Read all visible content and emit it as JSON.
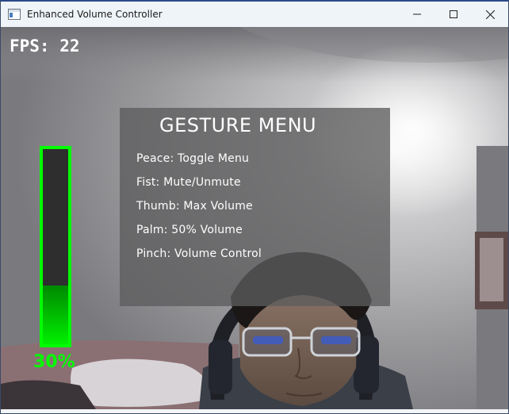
{
  "window": {
    "title": "Enhanced Volume Controller",
    "controls": [
      "minimize",
      "maximize",
      "close"
    ]
  },
  "overlay": {
    "fps_label": "FPS: 22",
    "menu": {
      "title": "GESTURE MENU",
      "items": [
        "Peace: Toggle Menu",
        "Fist: Mute/Unmute",
        "Thumb: Max Volume",
        "Palm: 50% Volume",
        "Pinch: Volume Control"
      ]
    },
    "volume": {
      "level": 0.3,
      "label": "30%",
      "color": "#00ff00"
    }
  },
  "icons": {
    "app": "app-window-icon",
    "minimize": "minimize-icon",
    "maximize": "maximize-icon",
    "close": "close-icon"
  }
}
